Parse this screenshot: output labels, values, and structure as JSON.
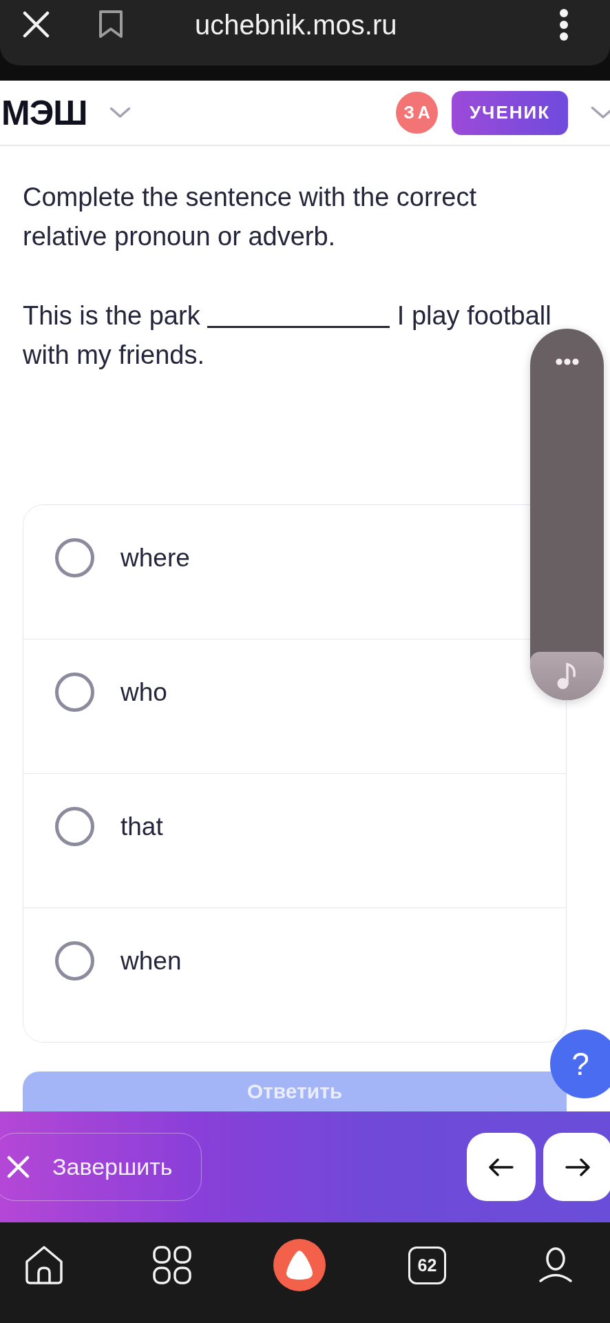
{
  "browser_bar": {
    "url": "uchebnik.mos.ru"
  },
  "header": {
    "logo": "МЭШ",
    "avatar_initials": "ЗА",
    "role": "УЧЕНИК"
  },
  "task": {
    "instruction": "Complete the sentence with the correct relative pronoun or adverb.",
    "sentence_before": "This is the park",
    "sentence_after": "I play football with my friends."
  },
  "options": [
    {
      "label": "where",
      "selected": false
    },
    {
      "label": "who",
      "selected": false
    },
    {
      "label": "that",
      "selected": false
    },
    {
      "label": "when",
      "selected": false
    }
  ],
  "submit_button": {
    "label": "Ответить",
    "disabled": true
  },
  "help_button": {
    "label": "?"
  },
  "bottom_bar": {
    "finish_label": "Завершить"
  },
  "nav_bar": {
    "tab_count": "62"
  }
}
